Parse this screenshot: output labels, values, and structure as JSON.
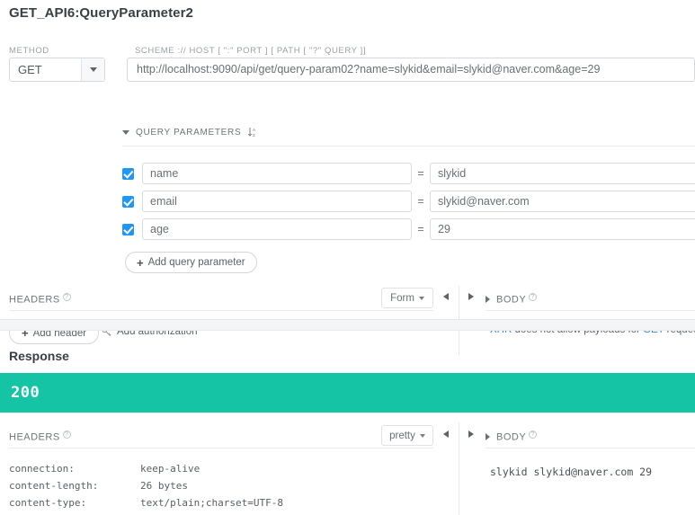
{
  "title": "GET_API6:QueryParameter2",
  "request": {
    "method_label": "METHOD",
    "method_value": "GET",
    "url_label": "SCHEME :// HOST [ \":\" PORT ] [ PATH [ \"?\" QUERY ]]",
    "url_value": "http://localhost:9090/api/get/query-param02?name=slykid&email=slykid@naver.com&age=29",
    "query_params": {
      "section_label": "QUERY PARAMETERS",
      "sort_icon": "sort-alpha-icon",
      "rows": [
        {
          "enabled": true,
          "key": "name",
          "eq": "=",
          "value": "slykid"
        },
        {
          "enabled": true,
          "key": "email",
          "eq": "=",
          "value": "slykid@naver.com"
        },
        {
          "enabled": true,
          "key": "age",
          "eq": "=",
          "value": "29"
        }
      ],
      "add_button": "Add query parameter"
    },
    "headers": {
      "label": "HEADERS",
      "form_select": "Form",
      "add_header_button": "Add header",
      "add_authorization": "Add authorization"
    },
    "body": {
      "label": "BODY",
      "note_part1": "XHR",
      "note_part2": " does not allow payloads for ",
      "note_part3": "GET",
      "note_part4": " request."
    }
  },
  "response": {
    "title": "Response",
    "status_code": "200",
    "status_color": "#15c3a5",
    "headers": {
      "label": "HEADERS",
      "pretty_select": "pretty",
      "rows": [
        {
          "key": "connection:",
          "value": "keep-alive"
        },
        {
          "key": "content-length:",
          "value": "26 bytes"
        },
        {
          "key": "content-type:",
          "value": "text/plain;charset=UTF-8"
        }
      ]
    },
    "body": {
      "label": "BODY",
      "content": "slykid slykid@naver.com 29"
    }
  }
}
